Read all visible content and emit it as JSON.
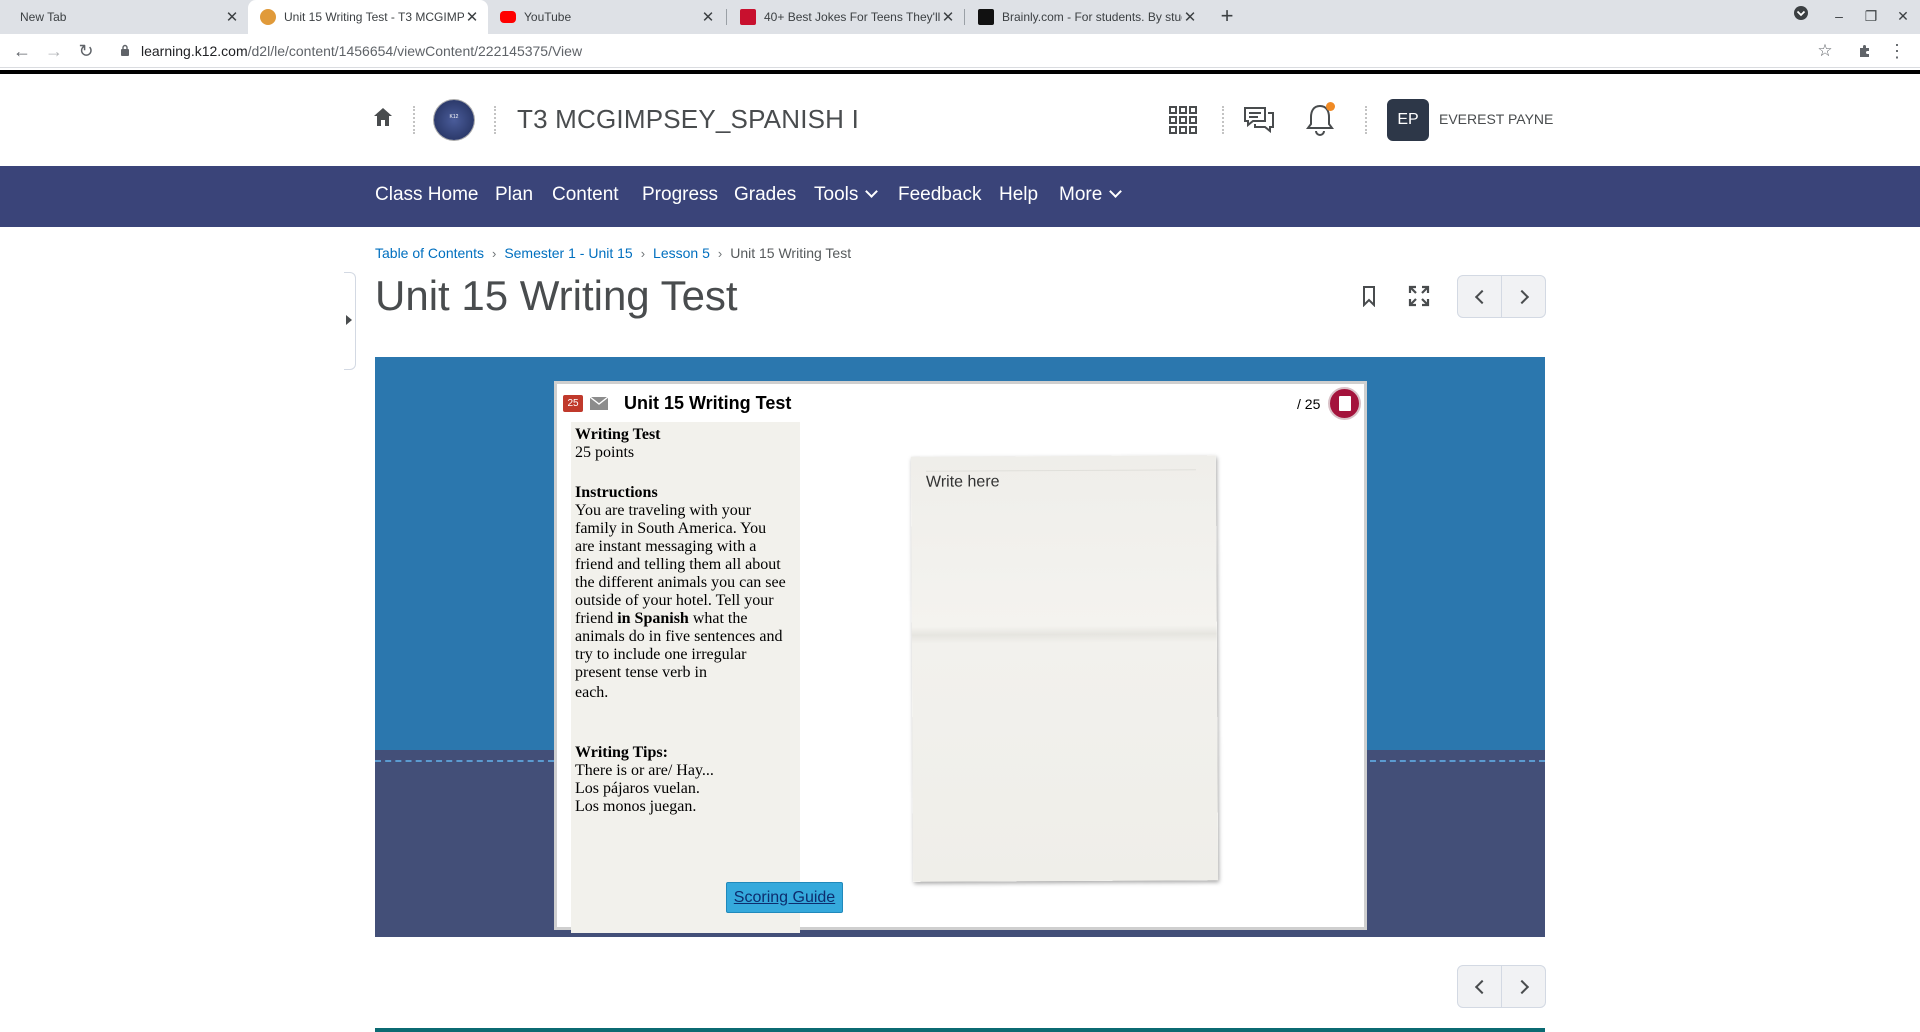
{
  "browser": {
    "tabs": [
      {
        "title": "New Tab",
        "active": false
      },
      {
        "title": "Unit 15 Writing Test - T3 MCGIMPSEY_SPANISH I",
        "active": true
      },
      {
        "title": "YouTube",
        "active": false
      },
      {
        "title": "40+ Best Jokes For Teens They'll Love",
        "active": false
      },
      {
        "title": "Brainly.com - For students. By students.",
        "active": false
      }
    ],
    "url_host": "learning.k12.com",
    "url_path": "/d2l/le/content/1456654/viewContent/222145375/View"
  },
  "header": {
    "course_title": "T3 MCGIMPSEY_SPANISH I",
    "avatar_initials": "EP",
    "user_name": "EVEREST PAYNE",
    "notification_dot_color": "#f08a24"
  },
  "nav": {
    "items": [
      "Class Home",
      "Plan",
      "Content",
      "Progress",
      "Grades",
      "Tools",
      "Feedback",
      "Help",
      "More"
    ]
  },
  "breadcrumb": {
    "items": [
      "Table of Contents",
      "Semester 1 - Unit 15",
      "Lesson 5"
    ],
    "current": "Unit 15 Writing Test"
  },
  "page": {
    "title": "Unit 15 Writing Test"
  },
  "activity": {
    "badge_number": "25",
    "title": "Unit 15 Writing Test",
    "score": "/ 25",
    "heading": "Writing Test",
    "points": "25 points",
    "instructions_heading": "Instructions",
    "instructions_part1": "You are traveling with your family in South America. You are instant messaging with a friend and telling them all about the different animals you can see outside of your hotel. Tell your friend",
    "instructions_bold": "in Spanish",
    "instructions_part2": "what the animals do in five sentences and try to include one irregular present tense verb in",
    "instructions_end": "each.",
    "tips_heading": "Writing Tips:",
    "tips": [
      "There is or are/ Hay...",
      "Los pájaros vuelan.",
      "Los monos juegan."
    ],
    "scoring_label": "Scoring Guide",
    "paper_placeholder": "Write here"
  },
  "colors": {
    "nav_bg": "#3a4479",
    "link": "#006fbf",
    "sky": "#2b77ae",
    "water": "#434f78",
    "scoring_button": "#35a9dc"
  }
}
